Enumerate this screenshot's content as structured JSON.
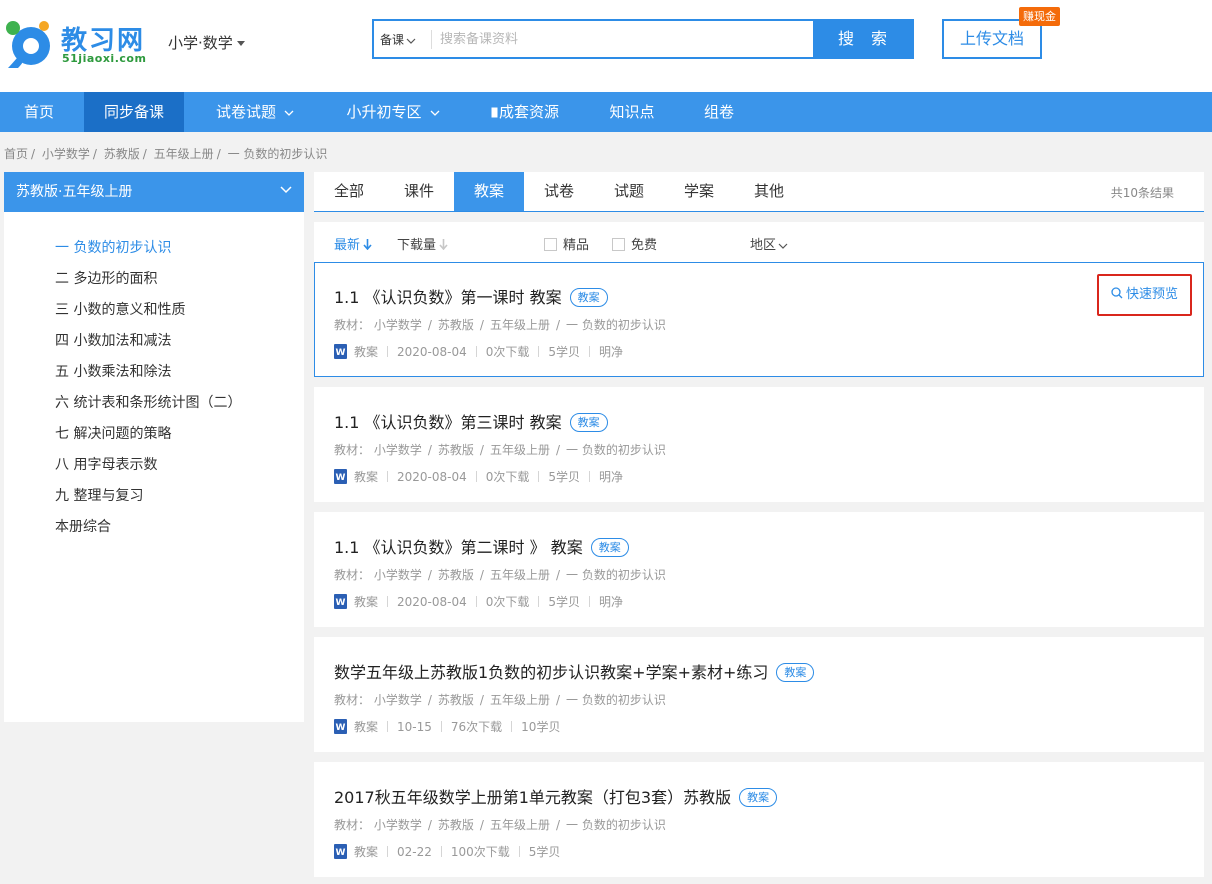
{
  "brand": {
    "name": "教习网",
    "domain": "51jiaoxi.com"
  },
  "grade_selector": "小学·数学",
  "search": {
    "category": "备课",
    "placeholder": "搜索备课资料",
    "button": "搜 索"
  },
  "upload": {
    "label": "上传文档",
    "badge": "赚现金"
  },
  "nav": [
    {
      "label": "首页"
    },
    {
      "label": "同步备课"
    },
    {
      "label": "试卷试题"
    },
    {
      "label": "小升初专区"
    },
    {
      "label": "成套资源"
    },
    {
      "label": "知识点"
    },
    {
      "label": "组卷"
    }
  ],
  "breadcrumb": [
    "首页",
    "小学数学",
    "苏教版",
    "五年级上册",
    "一 负数的初步认识"
  ],
  "sidebar": {
    "title": "苏教版·五年级上册",
    "items": [
      "一 负数的初步认识",
      "二 多边形的面积",
      "三 小数的意义和性质",
      "四 小数加法和减法",
      "五 小数乘法和除法",
      "六 统计表和条形统计图（二）",
      "七 解决问题的策略",
      "八 用字母表示数",
      "九 整理与复习",
      "本册综合"
    ]
  },
  "tabs": [
    "全部",
    "课件",
    "教案",
    "试卷",
    "试题",
    "学案",
    "其他"
  ],
  "total": "共10条结果",
  "filters": {
    "sort_latest": "最新",
    "sort_downloads": "下载量",
    "premium": "精品",
    "free": "免费",
    "region": "地区"
  },
  "results": [
    {
      "title": "1.1 《认识负数》第一课时 教案",
      "tag": "教案",
      "path_label": "教材：",
      "path": [
        "小学数学",
        "苏教版",
        "五年级上册",
        "一 负数的初步认识"
      ],
      "meta": [
        "教案",
        "2020-08-04",
        "0次下载",
        "5学贝",
        "明净"
      ]
    },
    {
      "title": "1.1 《认识负数》第三课时 教案",
      "tag": "教案",
      "path_label": "教材：",
      "path": [
        "小学数学",
        "苏教版",
        "五年级上册",
        "一 负数的初步认识"
      ],
      "meta": [
        "教案",
        "2020-08-04",
        "0次下载",
        "5学贝",
        "明净"
      ]
    },
    {
      "title": "1.1 《认识负数》第二课时 》 教案",
      "tag": "教案",
      "path_label": "教材：",
      "path": [
        "小学数学",
        "苏教版",
        "五年级上册",
        "一 负数的初步认识"
      ],
      "meta": [
        "教案",
        "2020-08-04",
        "0次下载",
        "5学贝",
        "明净"
      ]
    },
    {
      "title": "数学五年级上苏教版1负数的初步认识教案+学案+素材+练习",
      "tag": "教案",
      "path_label": "教材：",
      "path": [
        "小学数学",
        "苏教版",
        "五年级上册",
        "一 负数的初步认识"
      ],
      "meta": [
        "教案",
        "10-15",
        "76次下载",
        "10学贝"
      ]
    },
    {
      "title": "2017秋五年级数学上册第1单元教案（打包3套）苏教版",
      "tag": "教案",
      "path_label": "教材：",
      "path": [
        "小学数学",
        "苏教版",
        "五年级上册",
        "一 负数的初步认识"
      ],
      "meta": [
        "教案",
        "02-22",
        "100次下载",
        "5学贝"
      ]
    }
  ],
  "quick_preview": "快速预览",
  "colors": {
    "primary": "#2d8ce6",
    "nav_bg": "#3b95ea",
    "nav_active": "#1b6fc7",
    "badge": "#f46b0a",
    "highlight_border": "#d9261c"
  }
}
